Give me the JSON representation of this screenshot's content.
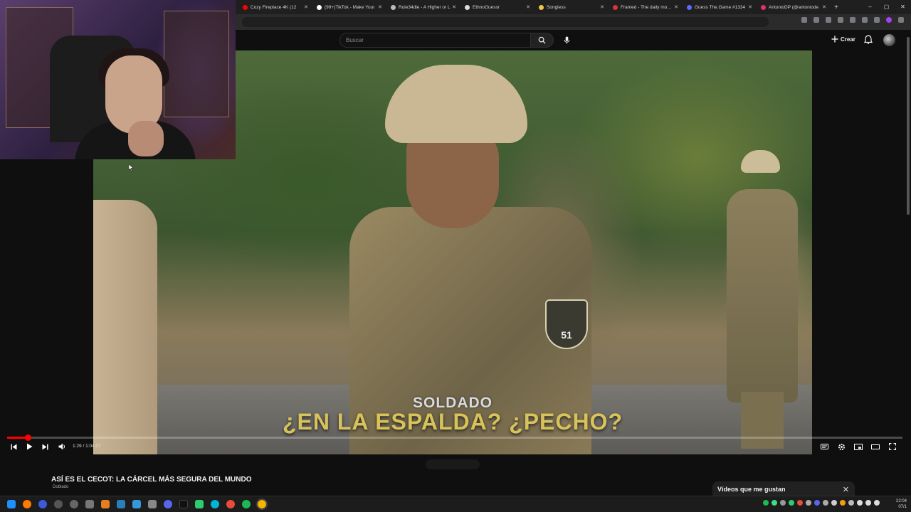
{
  "browser": {
    "tabs": [
      {
        "title": "Cozy Fireplace 4K (12",
        "favicon_color": "#ff0000"
      },
      {
        "title": "(99+)TikTok - Make Your",
        "favicon_color": "#ffffff"
      },
      {
        "title": "Rule34dle - A Higher or L",
        "favicon_color": "#bbbbbb"
      },
      {
        "title": "EthnoGuessr",
        "favicon_color": "#dddddd"
      },
      {
        "title": "Songless",
        "favicon_color": "#f5c542"
      },
      {
        "title": "Framed - The daily movie",
        "favicon_color": "#d33"
      },
      {
        "title": "Guess The.Game #1334",
        "favicon_color": "#5a6cff"
      },
      {
        "title": "AntonioDP (@antoniode",
        "favicon_color": "#e1306c"
      }
    ],
    "new_tab": "+"
  },
  "masthead": {
    "search_placeholder": "Buscar",
    "create_label": "Crear"
  },
  "video": {
    "subtitle_top": "SOLDADO",
    "subtitle_main": "¿EN LA ESPALDA? ¿PECHO?",
    "patch_number": "51",
    "time": "1:29 / 1:04:07",
    "progress_fraction": 0.023
  },
  "below": {
    "title": "ASÍ ES EL CECOT: LA CÁRCEL MÁS SEGURA DEL MUNDO",
    "subtitle": "Doblado",
    "liked_panel_title": "Vídeos que me gustan"
  },
  "taskbar": {
    "time": "22:04",
    "date": "07/1"
  }
}
